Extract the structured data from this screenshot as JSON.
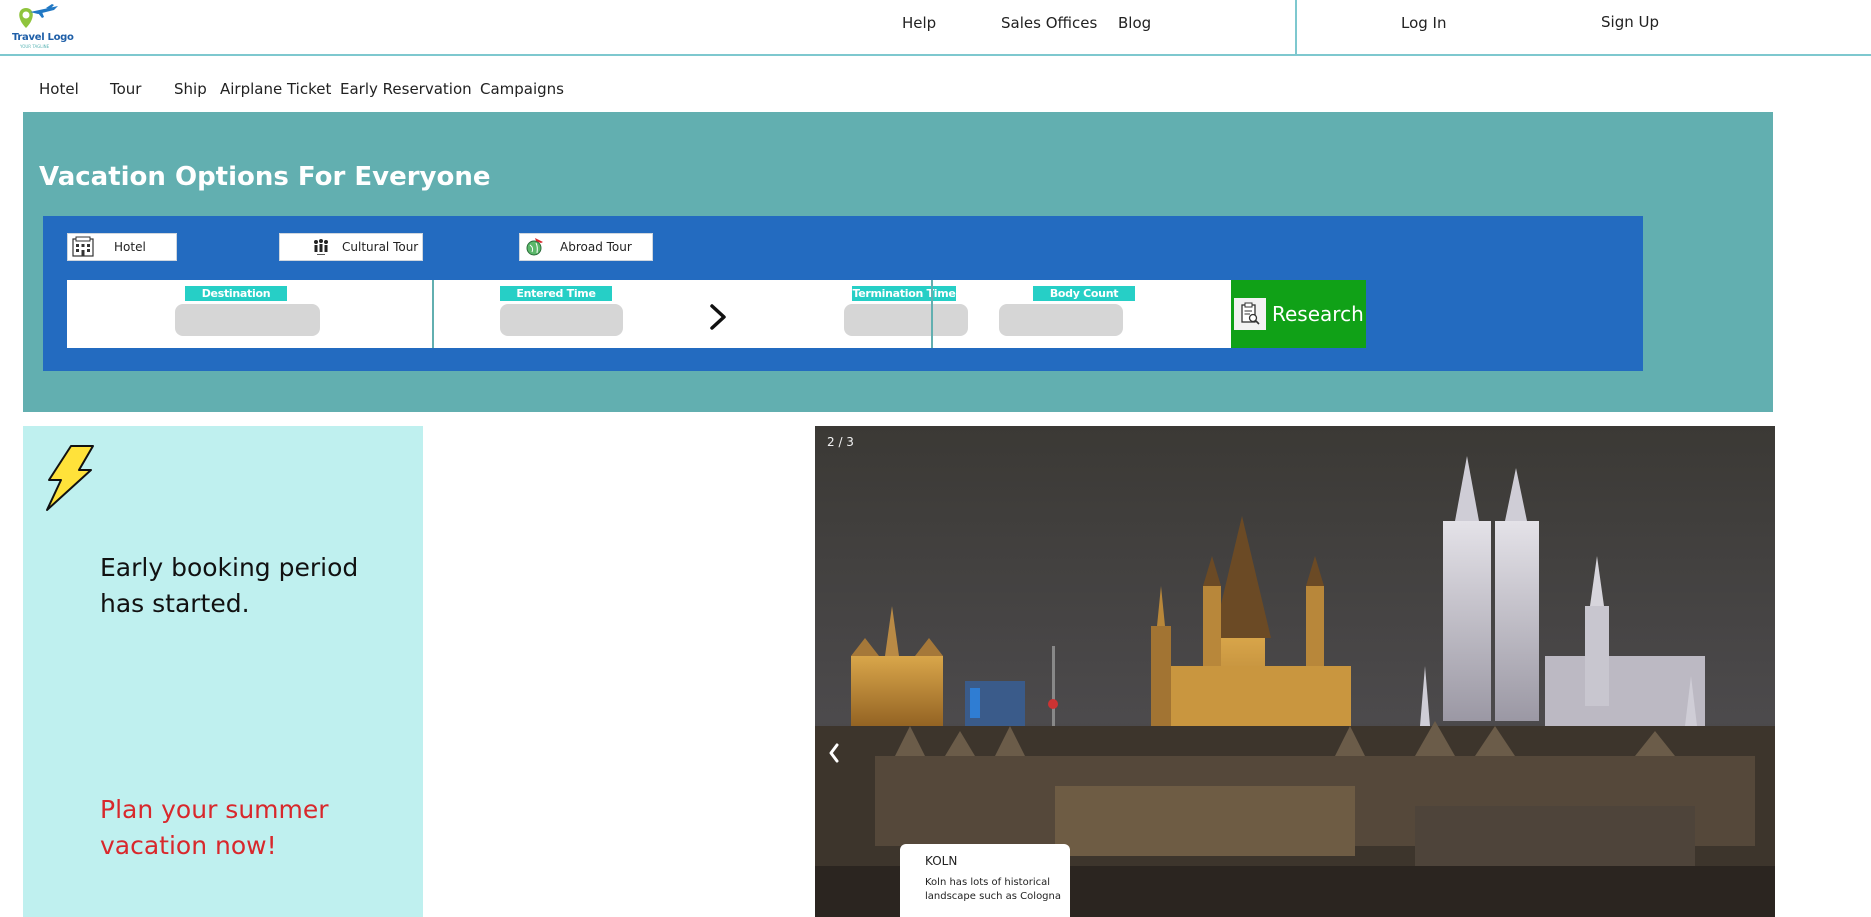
{
  "header": {
    "logo_text": "Travel Logo",
    "logo_tagline": "YOUR TAGLINE",
    "links": [
      "Help",
      "Sales Offices",
      "Blog"
    ],
    "login_label": "Log In",
    "signup_label": "Sign Up"
  },
  "categories": [
    "Hotel",
    "Tour",
    "Ship",
    "Airplane Ticket",
    "Early Reservation",
    "Campaigns"
  ],
  "hero": {
    "title": "Vacation Options For Everyone",
    "tabs": [
      {
        "label": "Hotel",
        "icon": "hotel-icon"
      },
      {
        "label": "Cultural Tour",
        "icon": "family-icon"
      },
      {
        "label": "Abroad Tour",
        "icon": "globe-plane-icon"
      }
    ],
    "fields": {
      "destination": {
        "label": "Destination",
        "value": ""
      },
      "entered_time": {
        "label": "Entered Time",
        "value": ""
      },
      "termination_time": {
        "label": "Termination Time",
        "value": ""
      },
      "body_count": {
        "label": "Body Count",
        "value": ""
      }
    },
    "research_label": "Research"
  },
  "promo": {
    "title": "Early booking period has started.",
    "cta": "Plan your summer vacation now!"
  },
  "slider": {
    "counter": "2 / 3",
    "caption_title": "KOLN",
    "caption_text": "Koln has lots of historical landscape such as Cologna"
  },
  "colors": {
    "hero_bg": "#62afb0",
    "panel_bg": "#236bc0",
    "field_label_bg": "#26cfc6",
    "research_bg": "#10a117",
    "promo_bg": "#bff0ef",
    "promo_cta": "#d8282c",
    "caption_button": "#6a24d9"
  }
}
